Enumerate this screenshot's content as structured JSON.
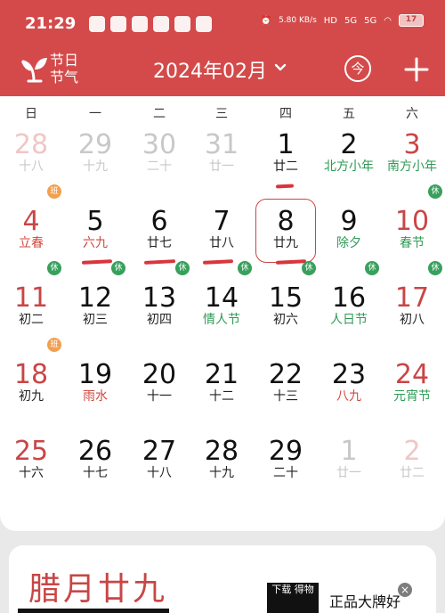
{
  "status_bar": {
    "time": "21:29",
    "network_speed": "5.80 KB/s",
    "hd_label": "HD",
    "signal_5g_1": "5G",
    "signal_5g_2": "5G",
    "battery_level": "17"
  },
  "header": {
    "app_name_top": "节日",
    "app_name_bottom": "节气",
    "month_title": "2024年02月",
    "today_label": "今",
    "add_label": "+"
  },
  "weekdays": [
    "日",
    "一",
    "二",
    "三",
    "四",
    "五",
    "六"
  ],
  "calendar_days": [
    {
      "solar": "28",
      "lunar": "十八",
      "type": "other",
      "weekend": true
    },
    {
      "solar": "29",
      "lunar": "十九",
      "type": "other"
    },
    {
      "solar": "30",
      "lunar": "二十",
      "type": "other"
    },
    {
      "solar": "31",
      "lunar": "廿一",
      "type": "other"
    },
    {
      "solar": "1",
      "lunar": "廿二",
      "type": "current",
      "underline": true
    },
    {
      "solar": "2",
      "lunar": "北方小年",
      "type": "current",
      "festival": "green"
    },
    {
      "solar": "3",
      "lunar": "南方小年",
      "type": "current",
      "weekend": true,
      "festival": "green"
    },
    {
      "solar": "4",
      "lunar": "立春",
      "type": "current",
      "weekend": true,
      "badge": "班",
      "festival": "red"
    },
    {
      "solar": "5",
      "lunar": "六九",
      "type": "current",
      "festival": "red",
      "underline": true
    },
    {
      "solar": "6",
      "lunar": "廿七",
      "type": "current",
      "underline": true
    },
    {
      "solar": "7",
      "lunar": "廿八",
      "type": "current",
      "underline": true
    },
    {
      "solar": "8",
      "lunar": "廿九",
      "type": "current",
      "selected": true,
      "underline": true
    },
    {
      "solar": "9",
      "lunar": "除夕",
      "type": "current",
      "festival": "green"
    },
    {
      "solar": "10",
      "lunar": "春节",
      "type": "current",
      "weekend": true,
      "badge": "休",
      "festival": "green"
    },
    {
      "solar": "11",
      "lunar": "初二",
      "type": "current",
      "weekend": true,
      "badge": "休"
    },
    {
      "solar": "12",
      "lunar": "初三",
      "type": "current",
      "badge": "休"
    },
    {
      "solar": "13",
      "lunar": "初四",
      "type": "current",
      "badge": "休"
    },
    {
      "solar": "14",
      "lunar": "情人节",
      "type": "current",
      "badge": "休",
      "festival": "green"
    },
    {
      "solar": "15",
      "lunar": "初六",
      "type": "current",
      "badge": "休"
    },
    {
      "solar": "16",
      "lunar": "人日节",
      "type": "current",
      "badge": "休",
      "festival": "green"
    },
    {
      "solar": "17",
      "lunar": "初八",
      "type": "current",
      "weekend": true,
      "badge": "休"
    },
    {
      "solar": "18",
      "lunar": "初九",
      "type": "current",
      "weekend": true,
      "badge": "班"
    },
    {
      "solar": "19",
      "lunar": "雨水",
      "type": "current",
      "festival": "red"
    },
    {
      "solar": "20",
      "lunar": "十一",
      "type": "current"
    },
    {
      "solar": "21",
      "lunar": "十二",
      "type": "current"
    },
    {
      "solar": "22",
      "lunar": "十三",
      "type": "current"
    },
    {
      "solar": "23",
      "lunar": "八九",
      "type": "current",
      "festival": "red"
    },
    {
      "solar": "24",
      "lunar": "元宵节",
      "type": "current",
      "weekend": true,
      "festival": "green"
    },
    {
      "solar": "25",
      "lunar": "十六",
      "type": "current",
      "weekend": true
    },
    {
      "solar": "26",
      "lunar": "十七",
      "type": "current"
    },
    {
      "solar": "27",
      "lunar": "十八",
      "type": "current"
    },
    {
      "solar": "28",
      "lunar": "十九",
      "type": "current"
    },
    {
      "solar": "29",
      "lunar": "二十",
      "type": "current"
    },
    {
      "solar": "1",
      "lunar": "廿一",
      "type": "other"
    },
    {
      "solar": "2",
      "lunar": "廿二",
      "type": "other",
      "weekend": true
    }
  ],
  "bottom_panel": {
    "lunar_title": "腊月廿九",
    "ad_tag": "下载\n得物",
    "ad_text": "正品大牌好",
    "ad_close": "×"
  },
  "colors": {
    "brand_red": "#d44a4a",
    "festival_green": "#2f9a55",
    "rest_badge": "#38a05d",
    "work_badge": "#f2a050",
    "mark_red": "#d8353c"
  },
  "icons": {
    "logo": "sprout-logo-icon",
    "chevron": "chevron-down-icon",
    "today": "today-icon",
    "add": "add-icon",
    "close": "close-icon"
  }
}
